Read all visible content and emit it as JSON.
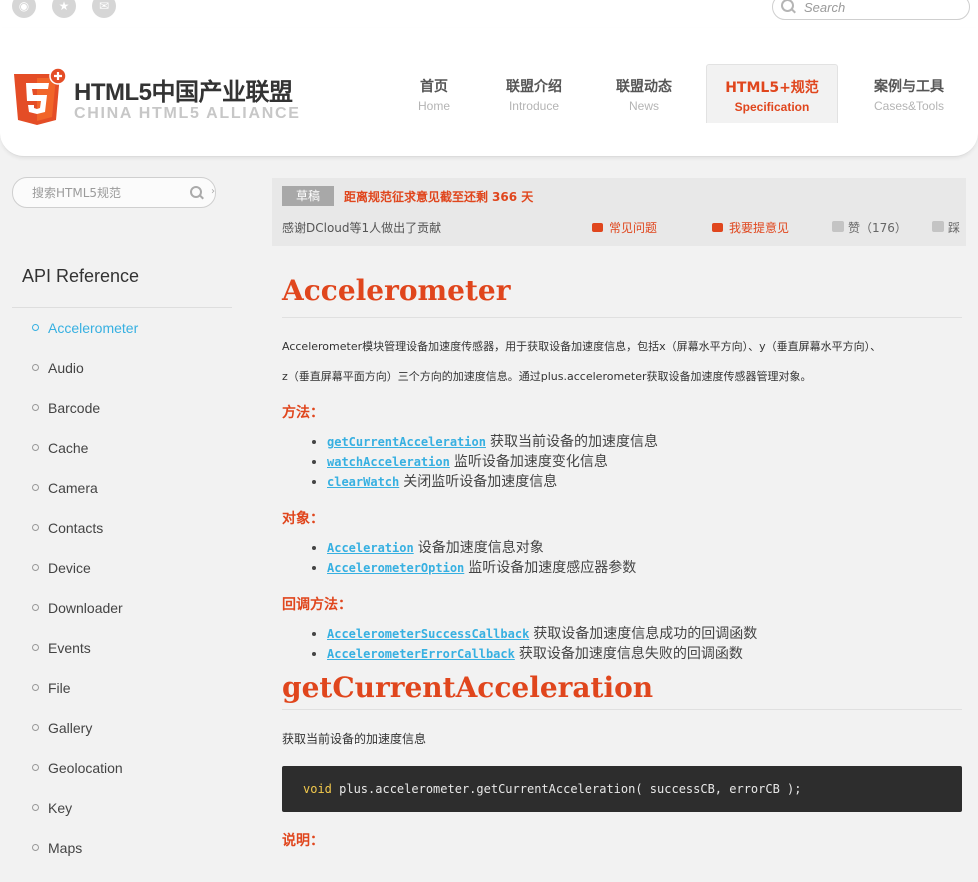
{
  "topbar": {
    "icons": [
      "eye-icon",
      "star-icon",
      "mail-icon"
    ],
    "search_placeholder": "Search"
  },
  "header": {
    "logo_title": "HTML5中国产业联盟",
    "logo_subtitle": "CHINA HTML5 ALLIANCE",
    "nav": [
      {
        "cn": "首页",
        "en": "Home"
      },
      {
        "cn": "联盟介绍",
        "en": "Introduce"
      },
      {
        "cn": "联盟动态",
        "en": "News"
      },
      {
        "cn": "HTML5+规范",
        "en": "Specification",
        "active": true
      },
      {
        "cn": "案例与工具",
        "en": "Cases&Tools"
      }
    ]
  },
  "sidebar": {
    "search_placeholder": "搜索HTML5规范",
    "title": "API Reference",
    "items": [
      "Accelerometer",
      "Audio",
      "Barcode",
      "Cache",
      "Camera",
      "Contacts",
      "Device",
      "Downloader",
      "Events",
      "File",
      "Gallery",
      "Geolocation",
      "Key",
      "Maps"
    ],
    "active_index": 0
  },
  "notice": {
    "badge": "草稿",
    "deadline_text": "距离规范征求意见截至还剩",
    "deadline_days": "366 天",
    "thanks": "感谢DCloud等1人做出了贡献",
    "faq": "常见问题",
    "suggest": "我要提意见",
    "like": "赞（176）",
    "dislike": "踩"
  },
  "content": {
    "title": "Accelerometer",
    "intro_1": "Accelerometer模块管理设备加速度传感器，用于获取设备加速度信息，包括x（屏幕水平方向）、y（垂直屏幕水平方向）、",
    "intro_2": "z（垂直屏幕平面方向）三个方向的加速度信息。通过plus.accelerometer获取设备加速度传感器管理对象。",
    "methods_heading": "方法：",
    "methods": [
      {
        "name": "getCurrentAcceleration",
        "desc": "获取当前设备的加速度信息"
      },
      {
        "name": "watchAcceleration",
        "desc": "监听设备加速度变化信息"
      },
      {
        "name": "clearWatch",
        "desc": "关闭监听设备加速度信息"
      }
    ],
    "objects_heading": "对象：",
    "objects": [
      {
        "name": "Acceleration",
        "desc": "设备加速度信息对象"
      },
      {
        "name": "AccelerometerOption",
        "desc": "监听设备加速度感应器参数"
      }
    ],
    "callbacks_heading": "回调方法：",
    "callbacks": [
      {
        "name": "AccelerometerSuccessCallback",
        "desc": "获取设备加速度信息成功的回调函数"
      },
      {
        "name": "AccelerometerErrorCallback",
        "desc": "获取设备加速度信息失败的回调函数"
      }
    ],
    "section2_title": "getCurrentAcceleration",
    "section2_desc": "获取当前设备的加速度信息",
    "code_keyword": "void",
    "code_rest": " plus.accelerometer.getCurrentAcceleration( successCB, errorCB );",
    "desc_heading": "说明："
  },
  "colors": {
    "accent": "#e0461d",
    "link": "#37b0e1",
    "code_bg": "#2d2d2d"
  }
}
